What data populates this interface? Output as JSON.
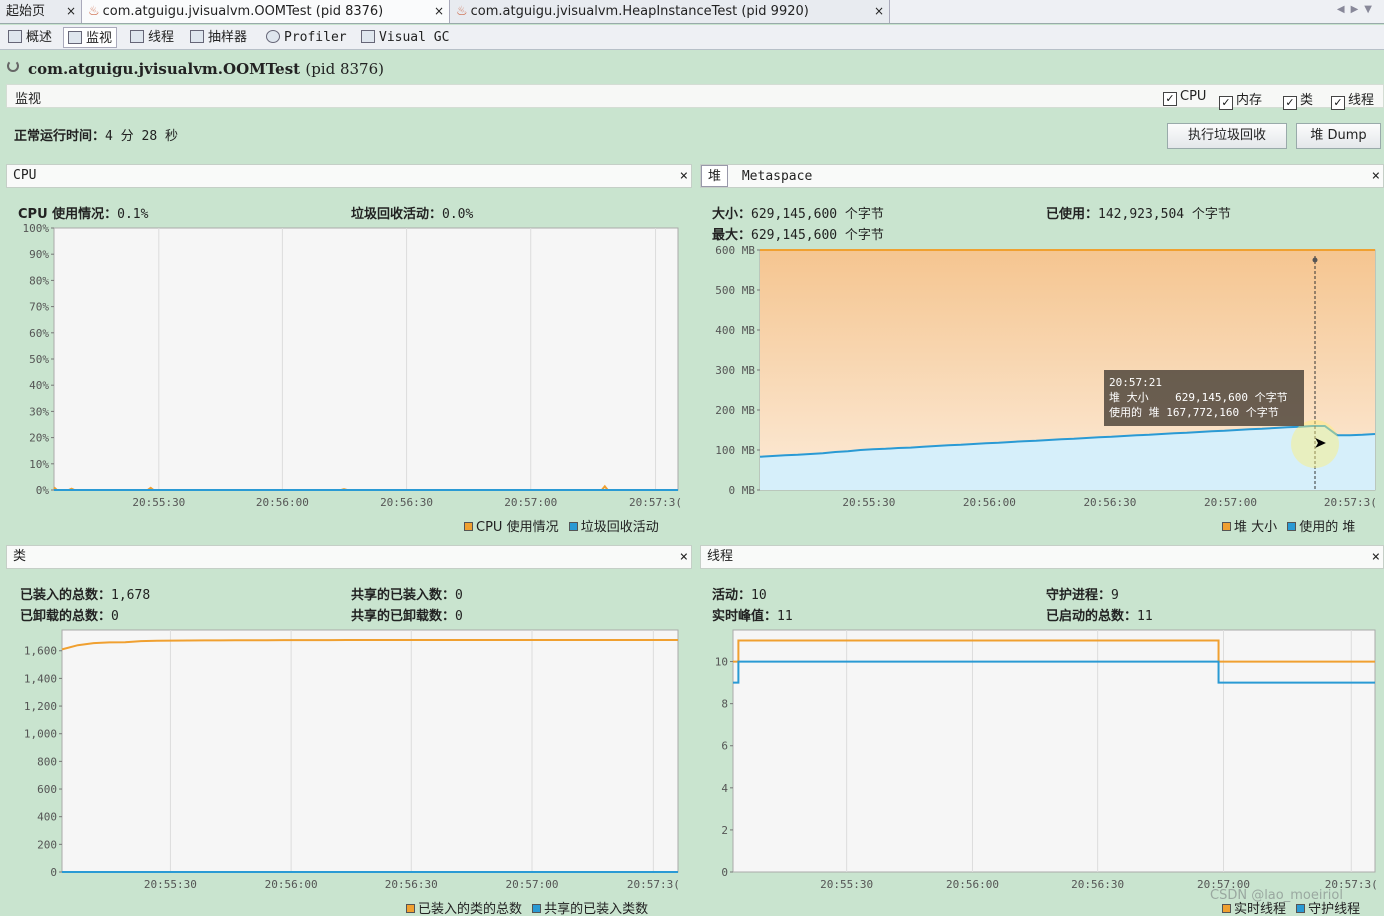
{
  "tabs": [
    {
      "label": "起始页"
    },
    {
      "label": "com.atguigu.jvisualvm.OOMTest (pid 8376)"
    },
    {
      "label": "com.atguigu.jvisualvm.HeapInstanceTest (pid 9920)"
    }
  ],
  "close_glyph": "×",
  "subtabs": [
    "概述",
    "监视",
    "线程",
    "抽样器",
    "Profiler",
    "Visual GC"
  ],
  "app": {
    "name": "com.atguigu.jvisualvm.OOMTest",
    "pid": "(pid 8376)"
  },
  "section": {
    "label": "监视",
    "checks": [
      "CPU",
      "内存",
      "类",
      "线程"
    ]
  },
  "uptime": {
    "label": "正常运行时间：",
    "value": "4 分 28 秒"
  },
  "buttons": {
    "gc": "执行垃圾回收",
    "dump": "堆 Dump"
  },
  "cpu_panel": {
    "title": "CPU",
    "usage_label": "CPU 使用情况：",
    "usage_value": "0.1%",
    "gc_label": "垃圾回收活动：",
    "gc_value": "0.0%",
    "legend": [
      "CPU 使用情况",
      "垃圾回收活动"
    ]
  },
  "heap_panel": {
    "tabs": [
      "堆",
      "Metaspace"
    ],
    "size_label": "大小：",
    "size_value": "629,145,600 个字节",
    "max_label": "最大：",
    "max_value": "629,145,600 个字节",
    "used_label": "已使用：",
    "used_value": "142,923,504 个字节",
    "tooltip": {
      "time": "20:57:21",
      "line1": "堆 大小    629,145,600 个字节",
      "line2": "使用的 堆 167,772,160 个字节"
    },
    "legend": [
      "堆 大小",
      "使用的 堆"
    ]
  },
  "class_panel": {
    "title": "类",
    "loaded_label": "已装入的总数：",
    "loaded_value": "1,678",
    "unloaded_label": "已卸载的总数：",
    "unloaded_value": "0",
    "shared_loaded_label": "共享的已装入数：",
    "shared_loaded_value": "0",
    "shared_unloaded_label": "共享的已卸载数：",
    "shared_unloaded_value": "0",
    "legend": [
      "已装入的类的总数",
      "共享的已装入类数"
    ]
  },
  "thread_panel": {
    "title": "线程",
    "live_label": "活动：",
    "live_value": "10",
    "peak_label": "实时峰值：",
    "peak_value": "11",
    "daemon_label": "守护进程：",
    "daemon_value": "9",
    "started_label": "已启动的总数：",
    "started_value": "11",
    "legend": [
      "实时线程",
      "守护线程"
    ]
  },
  "watermark": "CSDN @lao_moeiriol",
  "colors": {
    "orange": "#f0a030",
    "blue": "#2a9ad4",
    "bg": "#c9e4cf"
  },
  "chart_data": [
    {
      "type": "line",
      "name": "cpu",
      "x_ticks": [
        "20:55:30",
        "20:56:00",
        "20:56:30",
        "20:57:00",
        "20:57:3("
      ],
      "y_ticks": [
        "0%",
        "10%",
        "20%",
        "30%",
        "40%",
        "50%",
        "60%",
        "70%",
        "80%",
        "90%",
        "100%"
      ],
      "ylim": [
        0,
        100
      ],
      "series": [
        {
          "name": "CPU 使用情况",
          "color": "#f0a030",
          "values": [
            1,
            0,
            0,
            0,
            0,
            0,
            0.5,
            0,
            0,
            0,
            0,
            0,
            0,
            0,
            0,
            0,
            0,
            0,
            0,
            0,
            0,
            0,
            0,
            0,
            0,
            0,
            0,
            0,
            0,
            0,
            0,
            0,
            0,
            0.8,
            0,
            0,
            0,
            0,
            0,
            0,
            0,
            0,
            0,
            0,
            0,
            0,
            0,
            0,
            0,
            0,
            0,
            0,
            0,
            0,
            0,
            0,
            0,
            0,
            0,
            0,
            0,
            0,
            0,
            0,
            0,
            0,
            0,
            0,
            0,
            0,
            0,
            0,
            0,
            0,
            0,
            0,
            0,
            0,
            0,
            0,
            0,
            0,
            0,
            0,
            0,
            0,
            0,
            0,
            0,
            0,
            0,
            0,
            0,
            0,
            0,
            0,
            0,
            0,
            0,
            0.3,
            0,
            0,
            0,
            0,
            0,
            0,
            0,
            0,
            0,
            0,
            0,
            0,
            0,
            0,
            0,
            0,
            0,
            0,
            0,
            0,
            0,
            0,
            0,
            0,
            0,
            0,
            0,
            0,
            0,
            0,
            0,
            0,
            0,
            0,
            0,
            0,
            0,
            0,
            0,
            0,
            0,
            0,
            0,
            0,
            0,
            0,
            0,
            0,
            0,
            0,
            0,
            0,
            0,
            0,
            0,
            0,
            0,
            0,
            0,
            0,
            0,
            0,
            0,
            0,
            0,
            0,
            0,
            0,
            0,
            0,
            0,
            0,
            0,
            0,
            0,
            0,
            0,
            0,
            0,
            0,
            0,
            0,
            0,
            0,
            0,
            0,
            0,
            0,
            1.4,
            0,
            0,
            0,
            0,
            0,
            0,
            0,
            0,
            0,
            0,
            0,
            0,
            0,
            0,
            0,
            0,
            0,
            0,
            0,
            0,
            0,
            0,
            0,
            0,
            0
          ]
        },
        {
          "name": "垃圾回收活动",
          "color": "#2a9ad4",
          "values": [
            0,
            0
          ]
        }
      ]
    },
    {
      "type": "area",
      "name": "heap",
      "x_ticks": [
        "20:55:30",
        "20:56:00",
        "20:56:30",
        "20:57:00",
        "20:57:3("
      ],
      "y_ticks": [
        "0 MB",
        "100 MB",
        "200 MB",
        "300 MB",
        "400 MB",
        "500 MB",
        "600 MB"
      ],
      "ylim": [
        0,
        600
      ],
      "series": [
        {
          "name": "堆 大小",
          "color": "#f0a030",
          "values": [
            600,
            600
          ]
        },
        {
          "name": "使用的 堆",
          "color": "#2a9ad4",
          "values": [
            83,
            85,
            87,
            88,
            90,
            92,
            95,
            97,
            100,
            102,
            103,
            105,
            106,
            108,
            110,
            112,
            113,
            115,
            117,
            118,
            120,
            122,
            123,
            125,
            127,
            128,
            130,
            132,
            133,
            135,
            137,
            138,
            140,
            142,
            143,
            145,
            147,
            148,
            150,
            152,
            153,
            155,
            157,
            158,
            160,
            160,
            137,
            137,
            138,
            140
          ]
        }
      ]
    },
    {
      "type": "line",
      "name": "classes",
      "x_ticks": [
        "20:55:30",
        "20:56:00",
        "20:56:30",
        "20:57:00",
        "20:57:3("
      ],
      "y_ticks": [
        "0",
        "200",
        "400",
        "600",
        "800",
        "1,000",
        "1,200",
        "1,400",
        "1,600"
      ],
      "ylim": [
        0,
        1750
      ],
      "series": [
        {
          "name": "已装入的类的总数",
          "color": "#f0a030",
          "values": [
            1610,
            1640,
            1655,
            1660,
            1662,
            1670,
            1672,
            1673,
            1674,
            1675,
            1675,
            1676,
            1676,
            1676,
            1677,
            1677,
            1677,
            1677,
            1678,
            1678,
            1678,
            1678,
            1678,
            1678,
            1678,
            1678,
            1678,
            1678,
            1678,
            1678,
            1678,
            1678,
            1678,
            1678,
            1678,
            1678,
            1678,
            1678,
            1678,
            1678
          ]
        },
        {
          "name": "共享的已装入类数",
          "color": "#2a9ad4",
          "values": [
            0,
            0
          ]
        }
      ]
    },
    {
      "type": "line",
      "name": "threads",
      "x_ticks": [
        "20:55:30",
        "20:56:00",
        "20:56:30",
        "20:57:00",
        "20:57:3("
      ],
      "y_ticks": [
        "0",
        "2",
        "4",
        "6",
        "8",
        "10"
      ],
      "ylim": [
        0,
        11.5
      ],
      "series": [
        {
          "name": "实时线程",
          "color": "#f0a030",
          "values": [
            10,
            11,
            11,
            11,
            11,
            11,
            11,
            11,
            11,
            11,
            11,
            11,
            11,
            11,
            11,
            11,
            11,
            11,
            11,
            11,
            11,
            11,
            11,
            11,
            11,
            11,
            11,
            11,
            11,
            11,
            11,
            11,
            11,
            11,
            11,
            11,
            11,
            11,
            11,
            11,
            11,
            11,
            11,
            11,
            11,
            11,
            11,
            11,
            11,
            11,
            11,
            11,
            11,
            11,
            11,
            11,
            11,
            11,
            11,
            11,
            11,
            11,
            11,
            11,
            11,
            11,
            11,
            11,
            11,
            11,
            11,
            11,
            11,
            11,
            11,
            11,
            11,
            11,
            11,
            11,
            11,
            11,
            11,
            11,
            11,
            11,
            11,
            11,
            11,
            11,
            10,
            10,
            10,
            10,
            10,
            10,
            10,
            10,
            10,
            10,
            10,
            10,
            10,
            10,
            10,
            10,
            10,
            10,
            10,
            10,
            10,
            10,
            10,
            10,
            10,
            10,
            10,
            10,
            10,
            10
          ]
        },
        {
          "name": "守护线程",
          "color": "#2a9ad4",
          "values": [
            9,
            10,
            10,
            10,
            10,
            10,
            10,
            10,
            10,
            10,
            10,
            10,
            10,
            10,
            10,
            10,
            10,
            10,
            10,
            10,
            10,
            10,
            10,
            10,
            10,
            10,
            10,
            10,
            10,
            10,
            10,
            10,
            10,
            10,
            10,
            10,
            10,
            10,
            10,
            10,
            10,
            10,
            10,
            10,
            10,
            10,
            10,
            10,
            10,
            10,
            10,
            10,
            10,
            10,
            10,
            10,
            10,
            10,
            10,
            10,
            10,
            10,
            10,
            10,
            10,
            10,
            10,
            10,
            10,
            10,
            10,
            10,
            10,
            10,
            10,
            10,
            10,
            10,
            10,
            10,
            10,
            10,
            10,
            10,
            10,
            10,
            10,
            10,
            10,
            10,
            9,
            9,
            9,
            9,
            9,
            9,
            9,
            9,
            9,
            9,
            9,
            9,
            9,
            9,
            9,
            9,
            9,
            9,
            9,
            9,
            9,
            9,
            9,
            9,
            9,
            9,
            9,
            9,
            9,
            9
          ]
        }
      ]
    }
  ]
}
